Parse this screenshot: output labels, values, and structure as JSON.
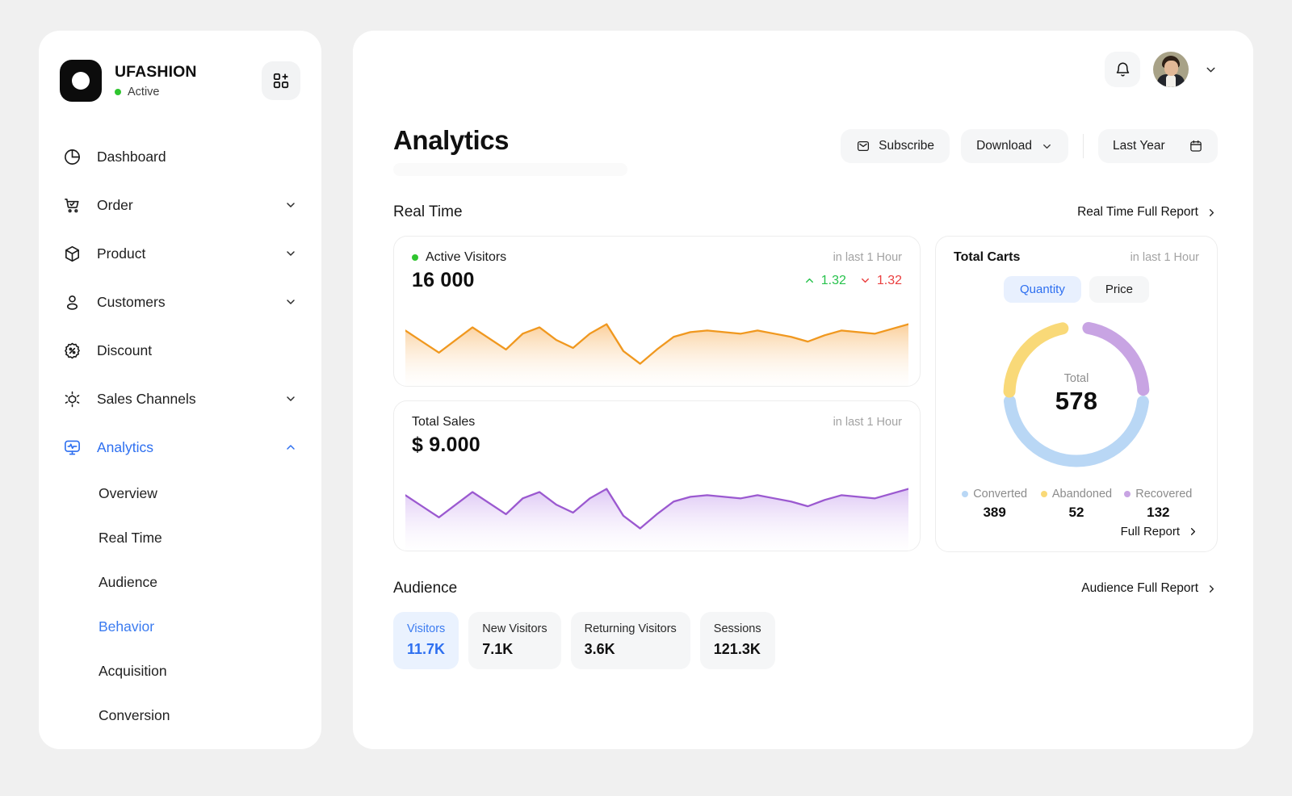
{
  "brand": {
    "name": "UFASHION",
    "status": "Active",
    "logo_icon": "circle-logo-icon",
    "action_icon": "add-app-icon"
  },
  "sidebar": {
    "items": [
      {
        "label": "Dashboard",
        "icon": "pie-chart-icon",
        "expandable": false,
        "active": false
      },
      {
        "label": "Order",
        "icon": "cart-check-icon",
        "expandable": true,
        "active": false
      },
      {
        "label": "Product",
        "icon": "cube-icon",
        "expandable": true,
        "active": false
      },
      {
        "label": "Customers",
        "icon": "user-icon",
        "expandable": true,
        "active": false
      },
      {
        "label": "Discount",
        "icon": "discount-icon",
        "expandable": false,
        "active": false
      },
      {
        "label": "Sales Channels",
        "icon": "channels-icon",
        "expandable": true,
        "active": false
      },
      {
        "label": "Analytics",
        "icon": "analytics-icon",
        "expandable": true,
        "active": true
      }
    ],
    "subitems": [
      {
        "label": "Overview",
        "active": false
      },
      {
        "label": "Real Time",
        "active": false
      },
      {
        "label": "Audience",
        "active": false
      },
      {
        "label": "Behavior",
        "active": true
      },
      {
        "label": "Acquisition",
        "active": false
      },
      {
        "label": "Conversion",
        "active": false
      }
    ]
  },
  "topbar": {
    "bell_icon": "bell-icon",
    "avatar_icon": "user-avatar",
    "caret_icon": "chevron-down-icon"
  },
  "header": {
    "title": "Analytics",
    "subscribe_label": "Subscribe",
    "subscribe_icon": "mail-icon",
    "download_label": "Download",
    "download_chevron": "chevron-down-icon",
    "date_label": "Last Year",
    "date_icon": "calendar-icon"
  },
  "realtime": {
    "section_title": "Real Time",
    "full_report_label": "Real Time Full Report",
    "full_report_chevron": "chevron-right-icon",
    "active_visitors": {
      "title": "Active Visitors",
      "period": "in last 1 Hour",
      "value": "16 000",
      "trend_up": "1.32",
      "trend_down": "1.32",
      "up_icon": "chevron-up-icon",
      "down_icon": "chevron-down-icon",
      "color": "#f0981f"
    },
    "total_sales": {
      "title": "Total Sales",
      "period": "in last 1 Hour",
      "value": "$ 9.000",
      "color": "#9b59d0"
    }
  },
  "total_carts": {
    "title": "Total Carts",
    "period": "in last 1 Hour",
    "tabs": [
      {
        "label": "Quantity",
        "active": true
      },
      {
        "label": "Price",
        "active": false
      }
    ],
    "center_label": "Total",
    "total": "578",
    "full_report_label": "Full Report",
    "full_report_chevron": "chevron-right-icon",
    "legend": [
      {
        "name": "Converted",
        "value": "389",
        "color": "#b9d7f5"
      },
      {
        "name": "Abandoned",
        "value": "52",
        "color": "#f9d978"
      },
      {
        "name": "Recovered",
        "value": "132",
        "color": "#c8a4e3"
      }
    ]
  },
  "audience": {
    "section_title": "Audience",
    "full_report_label": "Audience Full Report",
    "full_report_chevron": "chevron-right-icon",
    "tabs": [
      {
        "label": "Visitors",
        "value": "11.7K",
        "active": true
      },
      {
        "label": "New Visitors",
        "value": "7.1K",
        "active": false
      },
      {
        "label": "Returning Visitors",
        "value": "3.6K",
        "active": false
      },
      {
        "label": "Sessions",
        "value": "121.3K",
        "active": false
      }
    ]
  },
  "chart_data": [
    {
      "type": "area",
      "title": "Active Visitors",
      "series": [
        {
          "name": "Active Visitors",
          "values": [
            70,
            56,
            42,
            58,
            74,
            60,
            46,
            66,
            74,
            58,
            48,
            66,
            78,
            44,
            28,
            46,
            62,
            68,
            70,
            68,
            66,
            70,
            66,
            62,
            56,
            64,
            70,
            68,
            66,
            72,
            78
          ]
        }
      ],
      "ylim": [
        0,
        100
      ],
      "grid": false,
      "legend": "none",
      "color": "#f0981f",
      "xlabel": "",
      "ylabel": "",
      "tick_labels": []
    },
    {
      "type": "area",
      "title": "Total Sales",
      "series": [
        {
          "name": "Total Sales",
          "values": [
            70,
            56,
            42,
            58,
            74,
            60,
            46,
            66,
            74,
            58,
            48,
            66,
            78,
            44,
            28,
            46,
            62,
            68,
            70,
            68,
            66,
            70,
            66,
            62,
            56,
            64,
            70,
            68,
            66,
            72,
            78
          ]
        }
      ],
      "ylim": [
        0,
        100
      ],
      "grid": false,
      "legend": "none",
      "color": "#9b59d0",
      "xlabel": "",
      "ylabel": "",
      "tick_labels": []
    },
    {
      "type": "pie",
      "title": "Total Carts",
      "labels": [
        "Converted",
        "Abandoned",
        "Recovered"
      ],
      "values": [
        389,
        52,
        132
      ],
      "colors": [
        "#b9d7f5",
        "#f9d978",
        "#c8a4e3"
      ],
      "total": 578,
      "center_label": "Total",
      "legend": "bottom"
    }
  ]
}
